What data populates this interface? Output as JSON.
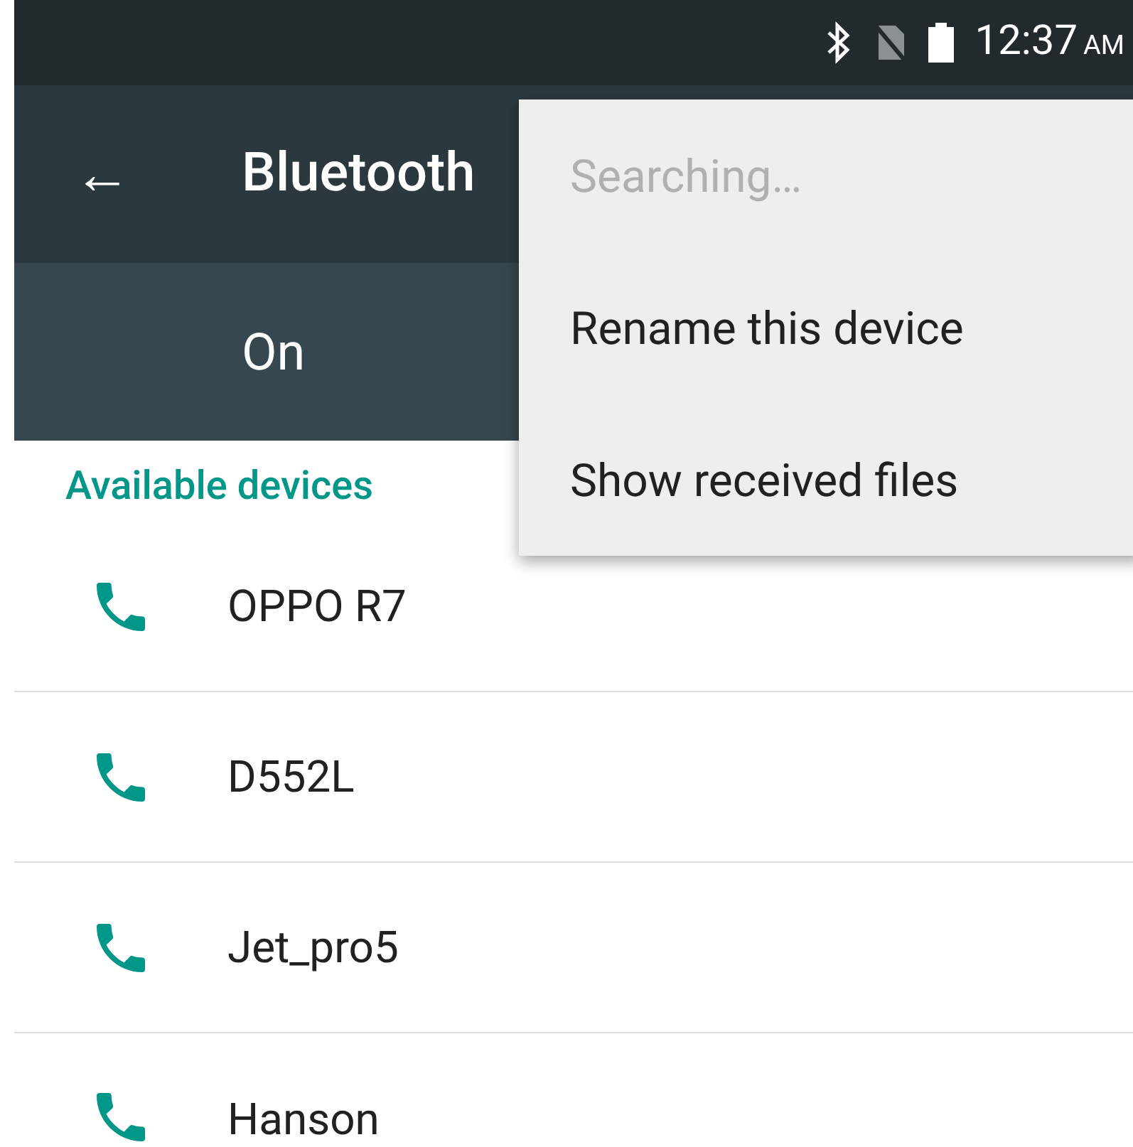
{
  "status_bar": {
    "time": "12:37",
    "ampm": "AM"
  },
  "toolbar": {
    "back_glyph": "←",
    "title": "Bluetooth"
  },
  "master_switch": {
    "label": "On"
  },
  "section_title": "Available devices",
  "devices": [
    {
      "name": "OPPO R7"
    },
    {
      "name": "D552L"
    },
    {
      "name": "Jet_pro5"
    },
    {
      "name": "Hanson"
    }
  ],
  "menu": [
    {
      "label": "Searching…",
      "disabled": true
    },
    {
      "label": "Rename this device",
      "disabled": false
    },
    {
      "label": "Show received files",
      "disabled": false
    }
  ]
}
